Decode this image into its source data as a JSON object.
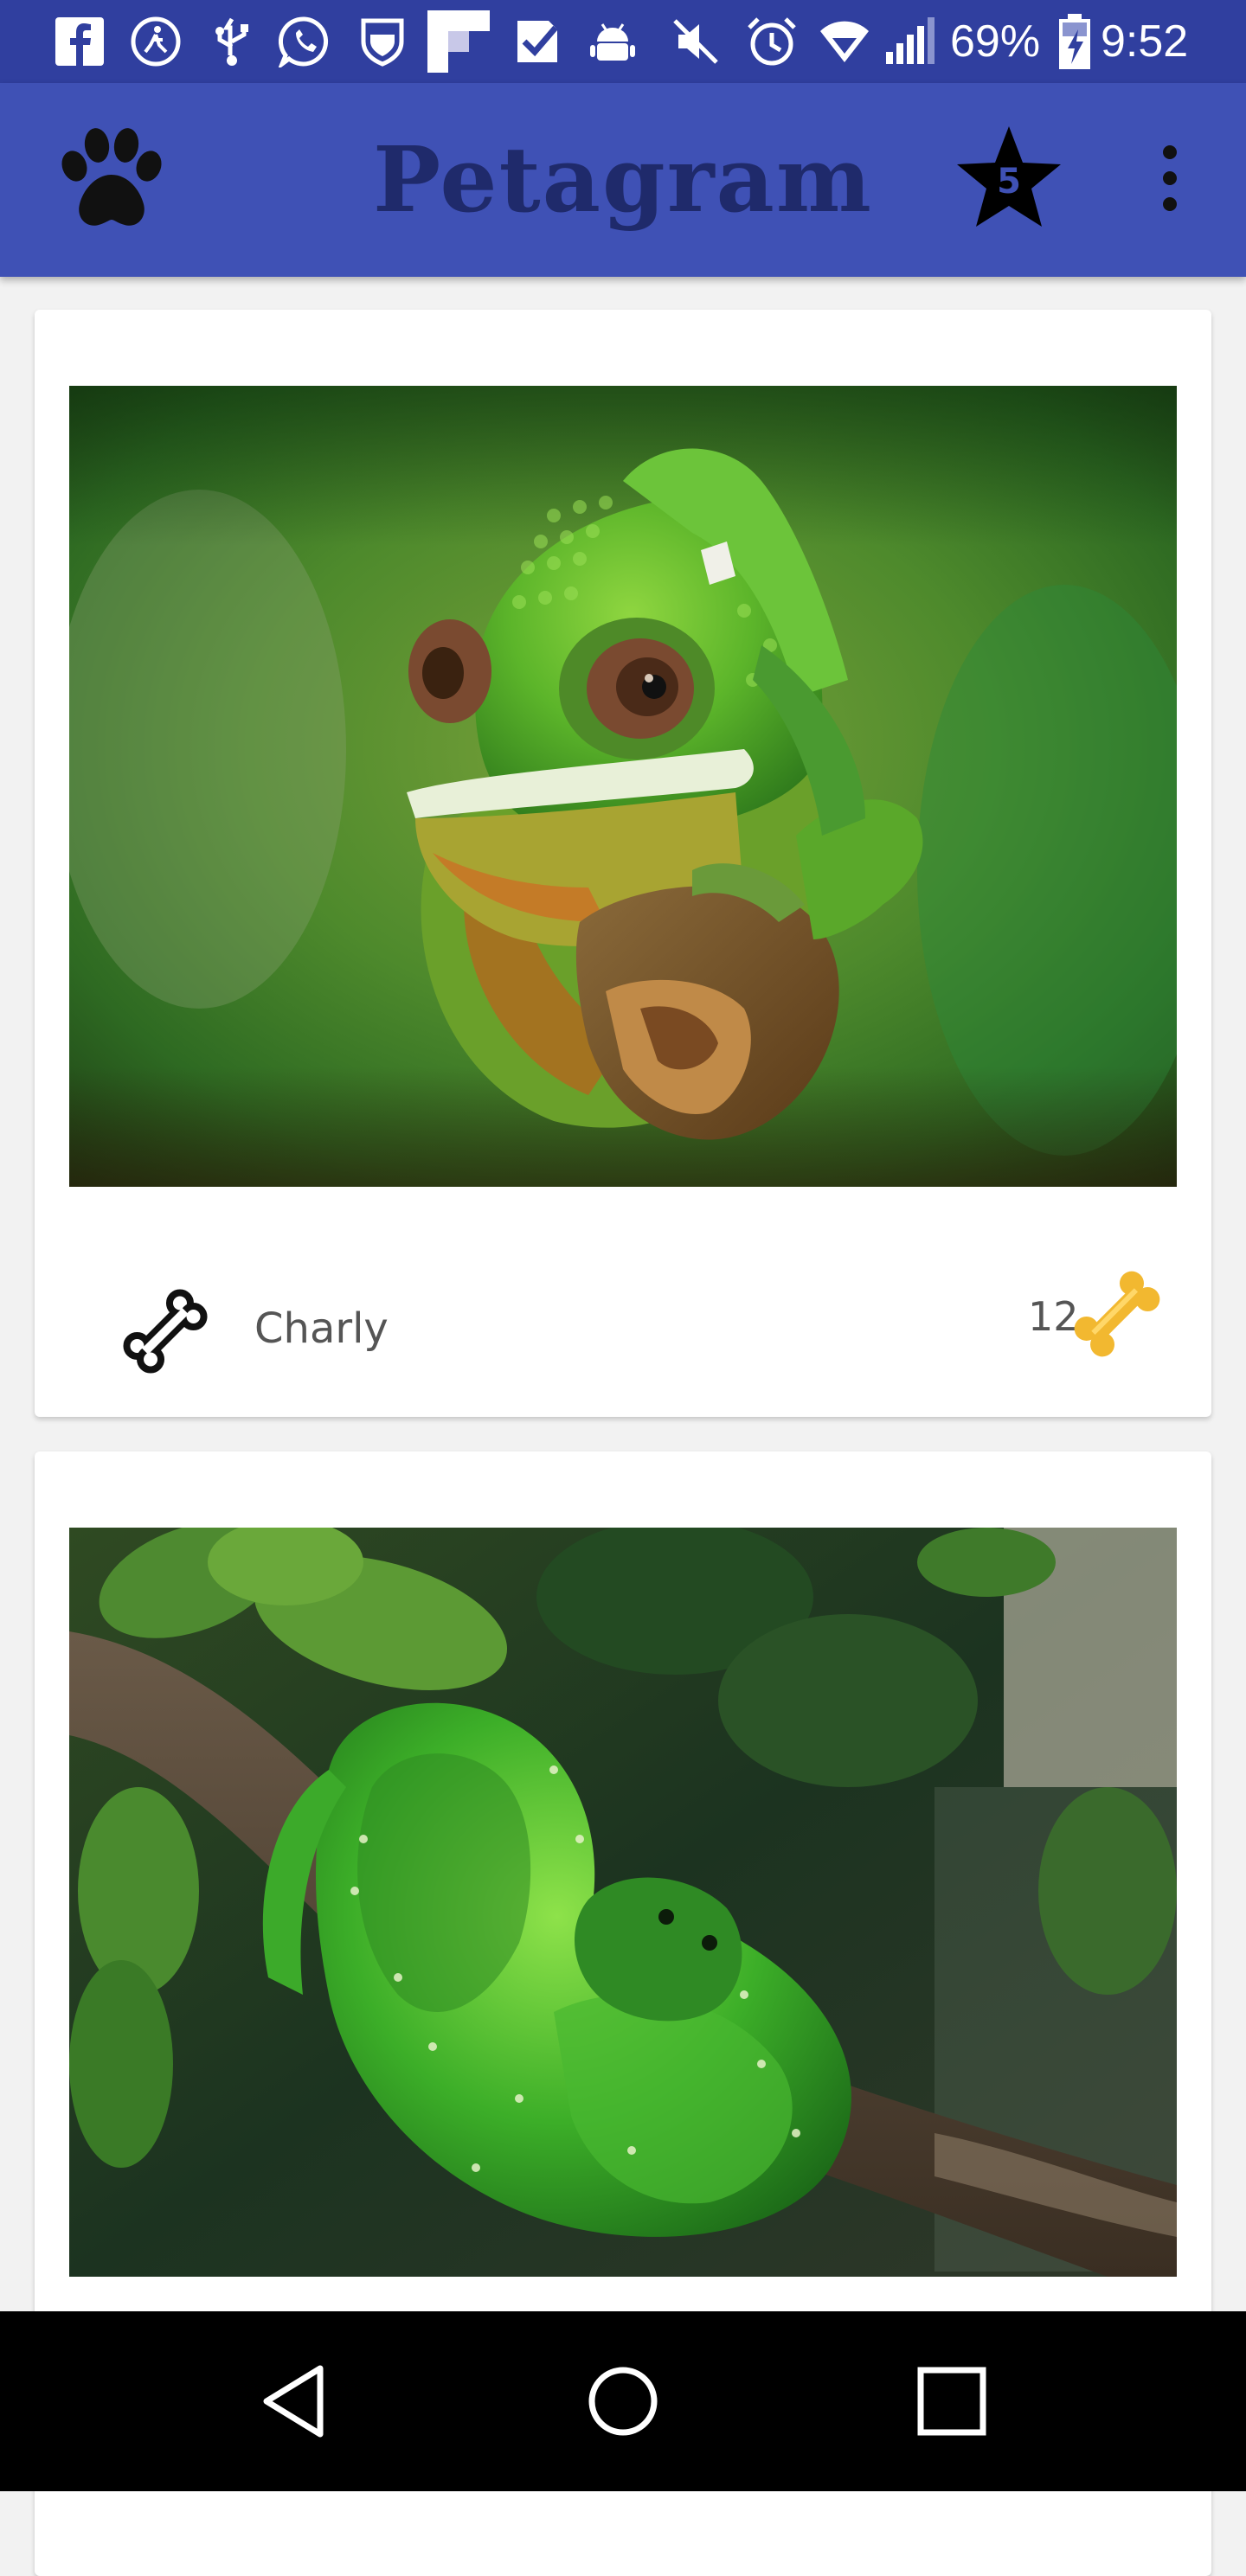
{
  "status_bar": {
    "battery": "69%",
    "time": "9:52",
    "icons": [
      "facebook-icon",
      "accessibility-icon",
      "usb-icon",
      "whatsapp-icon",
      "shield-icon",
      "flipboard-icon",
      "check-icon",
      "android-debug-icon",
      "mute-icon",
      "alarm-icon",
      "wifi-icon",
      "signal-icon",
      "battery-charging-icon"
    ]
  },
  "app_bar": {
    "title": "Petagram",
    "favorites_count": "5",
    "logo_icon": "paw-icon",
    "favorites_icon": "star-icon",
    "menu_icon": "overflow-menu-icon"
  },
  "pets": [
    {
      "name": "Charly",
      "likes": "12",
      "photo": "chameleon-photo",
      "like_icon": "bone-outline-icon",
      "likes_icon": "bone-gold-icon"
    },
    {
      "photo": "green-python-photo"
    }
  ],
  "nav_bar": {
    "icons": [
      "back-icon",
      "home-icon",
      "recents-icon"
    ]
  },
  "colors": {
    "status_bar": "#303f9f",
    "app_bar": "#3f51b5",
    "title": "#1f2a6b",
    "bone_gold": "#f2b830"
  }
}
